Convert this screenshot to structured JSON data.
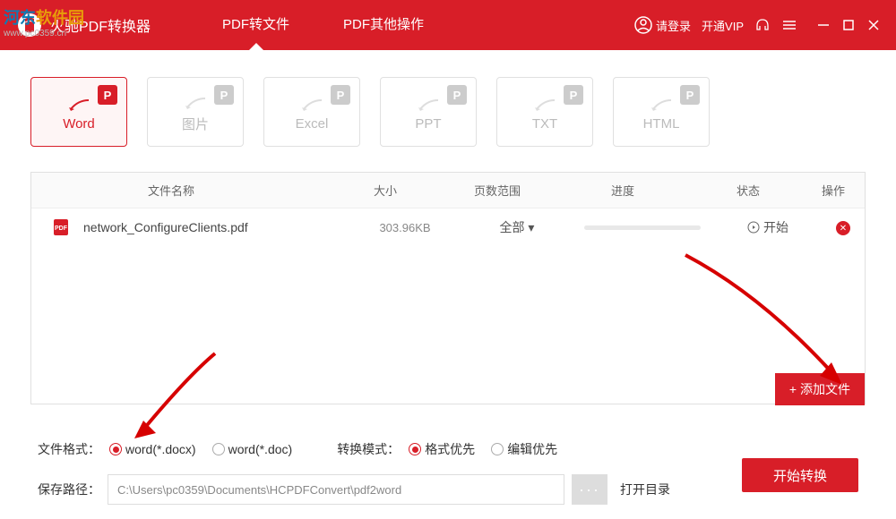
{
  "watermark": {
    "title_part1": "河东",
    "title_part2": "软件园",
    "url": "www.pc0359.cn"
  },
  "header": {
    "app_name": "火驰PDF转换器",
    "tabs": [
      {
        "label": "PDF转文件",
        "active": true
      },
      {
        "label": "PDF其他操作",
        "active": false
      }
    ],
    "login_label": "请登录",
    "vip_label": "开通VIP"
  },
  "format_cards": [
    {
      "label": "Word",
      "badge": "P",
      "active": true
    },
    {
      "label": "图片",
      "badge": "P",
      "active": false
    },
    {
      "label": "Excel",
      "badge": "P",
      "active": false
    },
    {
      "label": "PPT",
      "badge": "P",
      "active": false
    },
    {
      "label": "TXT",
      "badge": "P",
      "active": false
    },
    {
      "label": "HTML",
      "badge": "P",
      "active": false
    }
  ],
  "table": {
    "headers": {
      "name": "文件名称",
      "size": "大小",
      "range": "页数范围",
      "progress": "进度",
      "status": "状态",
      "action": "操作"
    },
    "rows": [
      {
        "name": "network_ConfigureClients.pdf",
        "size": "303.96KB",
        "range": "全部",
        "status": "开始"
      }
    ],
    "add_file_label": "添加文件"
  },
  "options": {
    "format_label": "文件格式：",
    "format_radios": [
      {
        "label": "word(*.docx)",
        "checked": true
      },
      {
        "label": "word(*.doc)",
        "checked": false
      }
    ],
    "mode_label": "转换模式：",
    "mode_radios": [
      {
        "label": "格式优先",
        "checked": true
      },
      {
        "label": "编辑优先",
        "checked": false
      }
    ],
    "path_label": "保存路径：",
    "path_value": "C:\\Users\\pc0359\\Documents\\HCPDFConvert\\pdf2word",
    "open_dir_label": "打开目录",
    "start_btn_label": "开始转换"
  },
  "colors": {
    "primary": "#d81e28"
  }
}
